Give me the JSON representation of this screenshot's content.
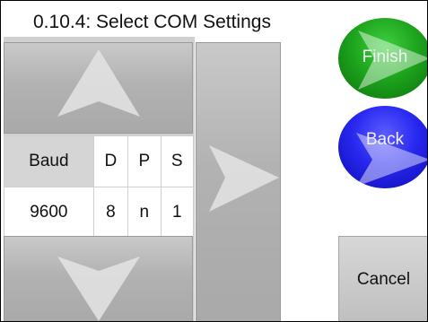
{
  "title": "0.10.4: Select COM Settings",
  "table": {
    "headers": [
      "Baud",
      "D",
      "P",
      "S"
    ],
    "values": [
      "9600",
      "8",
      "n",
      "1"
    ]
  },
  "buttons": {
    "finish": "Finish",
    "back": "Back",
    "cancel": "Cancel"
  },
  "icons": {
    "up": "up-arrow-icon",
    "down": "down-arrow-icon",
    "right": "right-arrow-icon"
  },
  "colors": {
    "finish": "#1ea61e",
    "back": "#2828f0",
    "panel": "#b2b2b2"
  }
}
